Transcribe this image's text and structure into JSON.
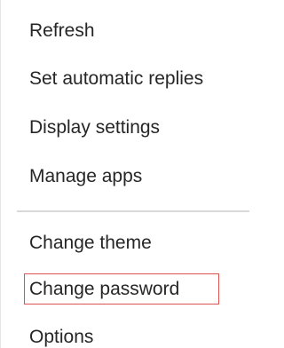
{
  "menu": {
    "items": [
      {
        "label": "Refresh"
      },
      {
        "label": "Set automatic replies"
      },
      {
        "label": "Display settings"
      },
      {
        "label": "Manage apps"
      },
      {
        "label": "Change theme"
      },
      {
        "label": "Change password"
      },
      {
        "label": "Options"
      }
    ],
    "highlight_color": "#e0524f"
  }
}
